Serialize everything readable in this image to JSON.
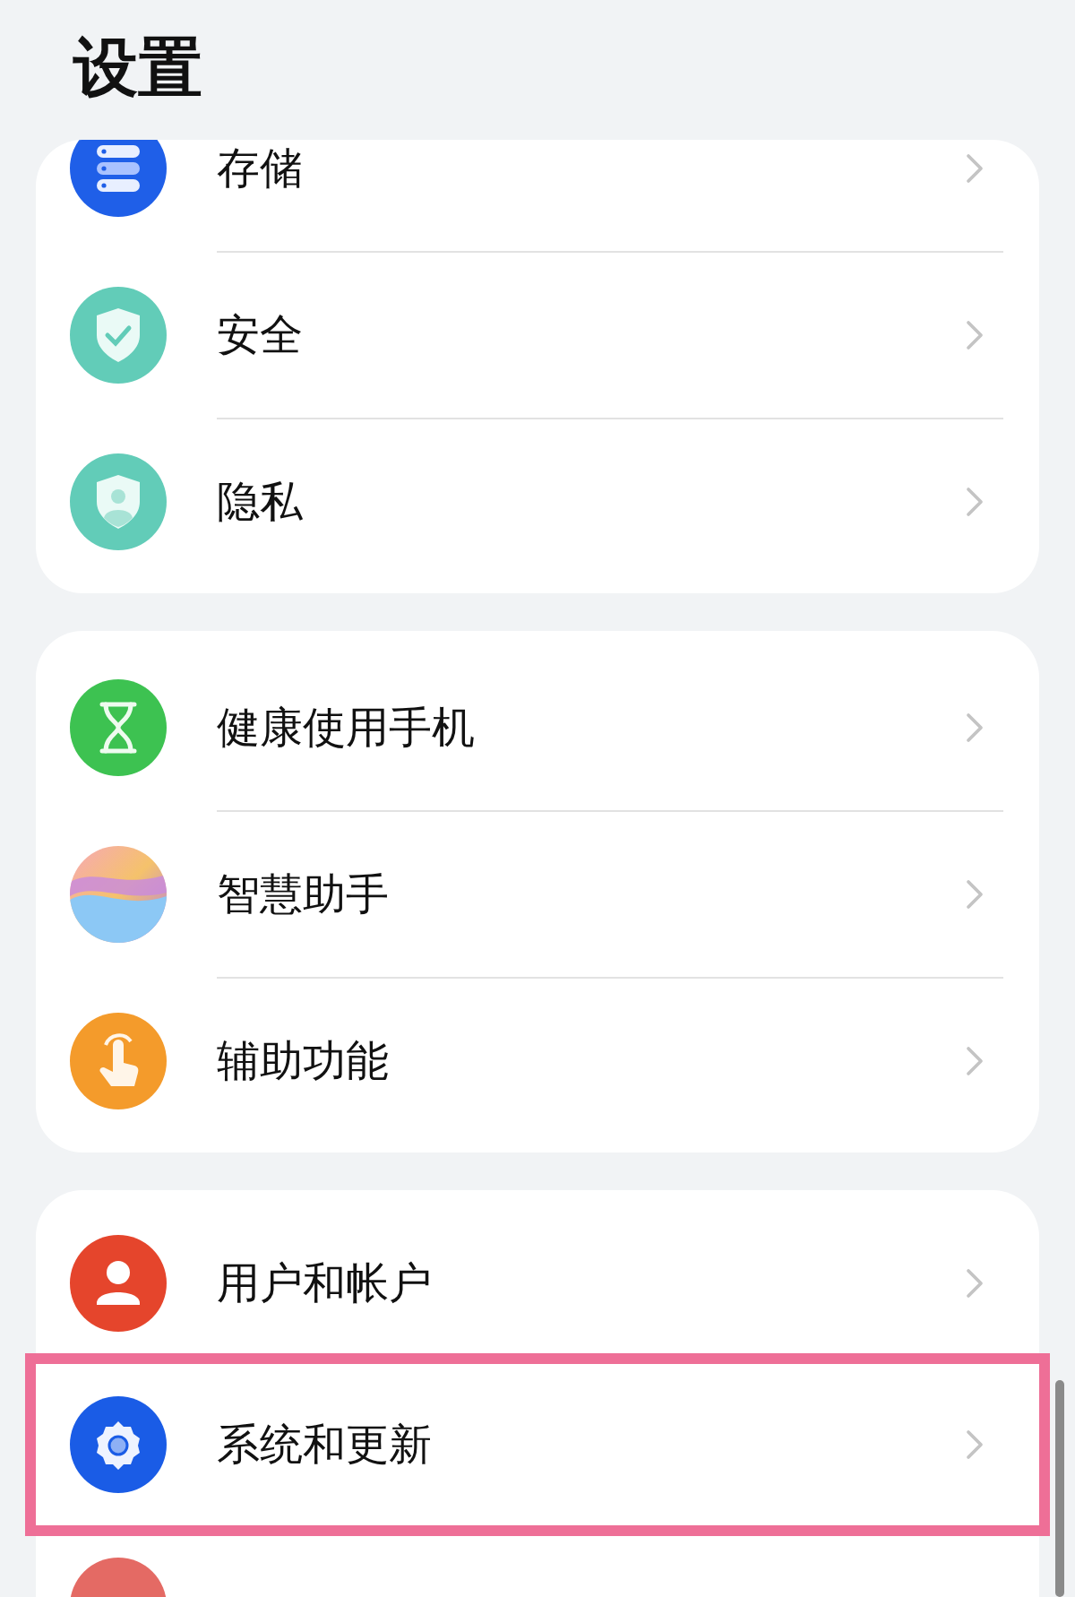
{
  "title": "设置",
  "groups": [
    {
      "items": [
        {
          "kind": "storage",
          "label": "存储",
          "highlighted": false
        },
        {
          "kind": "security",
          "label": "安全",
          "highlighted": false
        },
        {
          "kind": "privacy",
          "label": "隐私",
          "highlighted": false
        }
      ]
    },
    {
      "items": [
        {
          "kind": "hourglass",
          "label": "健康使用手机",
          "highlighted": false
        },
        {
          "kind": "assistant",
          "label": "智慧助手",
          "highlighted": false
        },
        {
          "kind": "accessibility",
          "label": "辅助功能",
          "highlighted": false
        }
      ]
    },
    {
      "items": [
        {
          "kind": "user",
          "label": "用户和帐户",
          "highlighted": false
        },
        {
          "kind": "gear",
          "label": "系统和更新",
          "highlighted": true
        },
        {
          "kind": "blank",
          "highlighted": false
        }
      ]
    }
  ]
}
